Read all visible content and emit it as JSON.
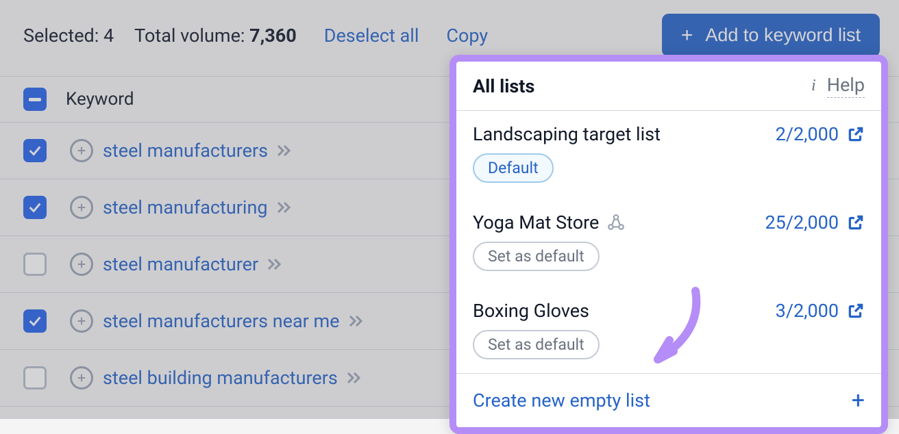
{
  "toolbar": {
    "selected_label": "Selected:",
    "selected_count": "4",
    "volume_label": "Total volume:",
    "volume_value": "7,360",
    "deselect_label": "Deselect all",
    "copy_label": "Copy",
    "add_label": "Add to keyword list"
  },
  "table": {
    "header_keyword": "Keyword",
    "rows": [
      {
        "keyword": "steel manufacturers",
        "checked": true
      },
      {
        "keyword": "steel manufacturing",
        "checked": true
      },
      {
        "keyword": "steel manufacturer",
        "checked": false
      },
      {
        "keyword": "steel manufacturers near me",
        "checked": true
      },
      {
        "keyword": "steel building manufacturers",
        "checked": false
      }
    ]
  },
  "popup": {
    "title": "All lists",
    "help_label": "Help",
    "lists": [
      {
        "name": "Landscaping target list",
        "count": "2/2,000",
        "default": true,
        "shared": false
      },
      {
        "name": "Yoga Mat Store",
        "count": "25/2,000",
        "default": false,
        "shared": true
      },
      {
        "name": "Boxing Gloves",
        "count": "3/2,000",
        "default": false,
        "shared": false
      }
    ],
    "default_badge": "Default",
    "set_default_label": "Set as default",
    "create_label": "Create new empty list"
  }
}
